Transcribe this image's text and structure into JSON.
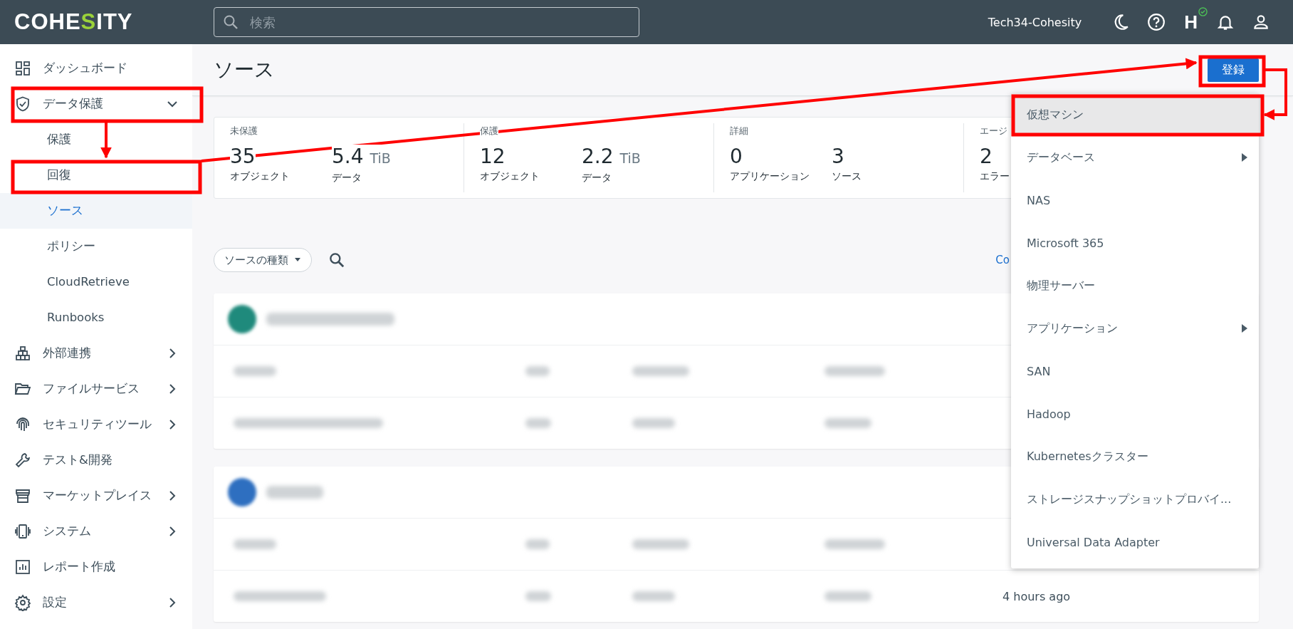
{
  "top_bar": {
    "logo": "COHESITY",
    "search": {
      "placeholder": "検索"
    },
    "cluster_name": "Tech34-Cohesity",
    "health_letter": "H"
  },
  "sidebar": {
    "items": [
      {
        "label": "ダッシュボード",
        "submenu": false,
        "selected": false
      },
      {
        "label": "データ保護",
        "submenu": true,
        "expanded": true,
        "selected": false,
        "children": [
          {
            "label": "保護",
            "selected": false
          },
          {
            "label": "回復",
            "selected": false
          },
          {
            "label": "ソース",
            "selected": true
          },
          {
            "label": "ポリシー",
            "selected": false
          },
          {
            "label": "CloudRetrieve",
            "selected": false
          },
          {
            "label": "Runbooks",
            "selected": false
          }
        ]
      },
      {
        "label": "外部連携",
        "submenu": true,
        "expanded": false,
        "selected": false
      },
      {
        "label": "ファイルサービス",
        "submenu": true,
        "expanded": false,
        "selected": false
      },
      {
        "label": "セキュリティツール",
        "submenu": true,
        "expanded": false,
        "selected": false
      },
      {
        "label": "テスト&開発",
        "submenu": false,
        "selected": false
      },
      {
        "label": "マーケットプレイス",
        "submenu": true,
        "expanded": false,
        "selected": false
      },
      {
        "label": "システム",
        "submenu": true,
        "expanded": false,
        "selected": false
      },
      {
        "label": "レポート作成",
        "submenu": false,
        "selected": false
      },
      {
        "label": "設定",
        "submenu": true,
        "expanded": false,
        "selected": false
      }
    ]
  },
  "page": {
    "title": "ソース",
    "register_button": "登録",
    "stats": [
      {
        "title": "未保護",
        "metrics": [
          {
            "value": "35",
            "label": "オブジェクト"
          },
          {
            "value": "5.4",
            "unit": "TiB",
            "label": "データ"
          }
        ]
      },
      {
        "title": "保護",
        "metrics": [
          {
            "value": "12",
            "label": "オブジェクト"
          },
          {
            "value": "2.2",
            "unit": "TiB",
            "label": "データ"
          }
        ]
      },
      {
        "title": "詳細",
        "metrics": [
          {
            "value": "0",
            "label": "アプリケーション"
          },
          {
            "value": "3",
            "label": "ソース"
          }
        ]
      },
      {
        "title": "エージ",
        "metrics": [
          {
            "value": "2",
            "label": "エラー"
          }
        ]
      }
    ],
    "filter": {
      "label": "ソースの種類"
    },
    "link": "Co",
    "source_groups": [
      {
        "color": "#1f8a7c"
      },
      {
        "color": "#2e6fc0",
        "last_updated": "4 hours ago"
      }
    ]
  },
  "register_menu": {
    "items": [
      {
        "label": "仮想マシン",
        "submenu": false,
        "selected": true
      },
      {
        "label": "データベース",
        "submenu": true,
        "selected": false
      },
      {
        "label": "NAS",
        "submenu": false,
        "selected": false
      },
      {
        "label": "Microsoft 365",
        "submenu": false,
        "selected": false
      },
      {
        "label": "物理サーバー",
        "submenu": false,
        "selected": false
      },
      {
        "label": "アプリケーション",
        "submenu": true,
        "selected": false
      },
      {
        "label": "SAN",
        "submenu": false,
        "selected": false
      },
      {
        "label": "Hadoop",
        "submenu": false,
        "selected": false
      },
      {
        "label": "Kubernetesクラスター",
        "submenu": false,
        "selected": false
      },
      {
        "label": "ストレージスナップショットプロバイ...",
        "submenu": false,
        "selected": false
      },
      {
        "label": "Universal Data Adapter",
        "submenu": false,
        "selected": false
      }
    ]
  }
}
